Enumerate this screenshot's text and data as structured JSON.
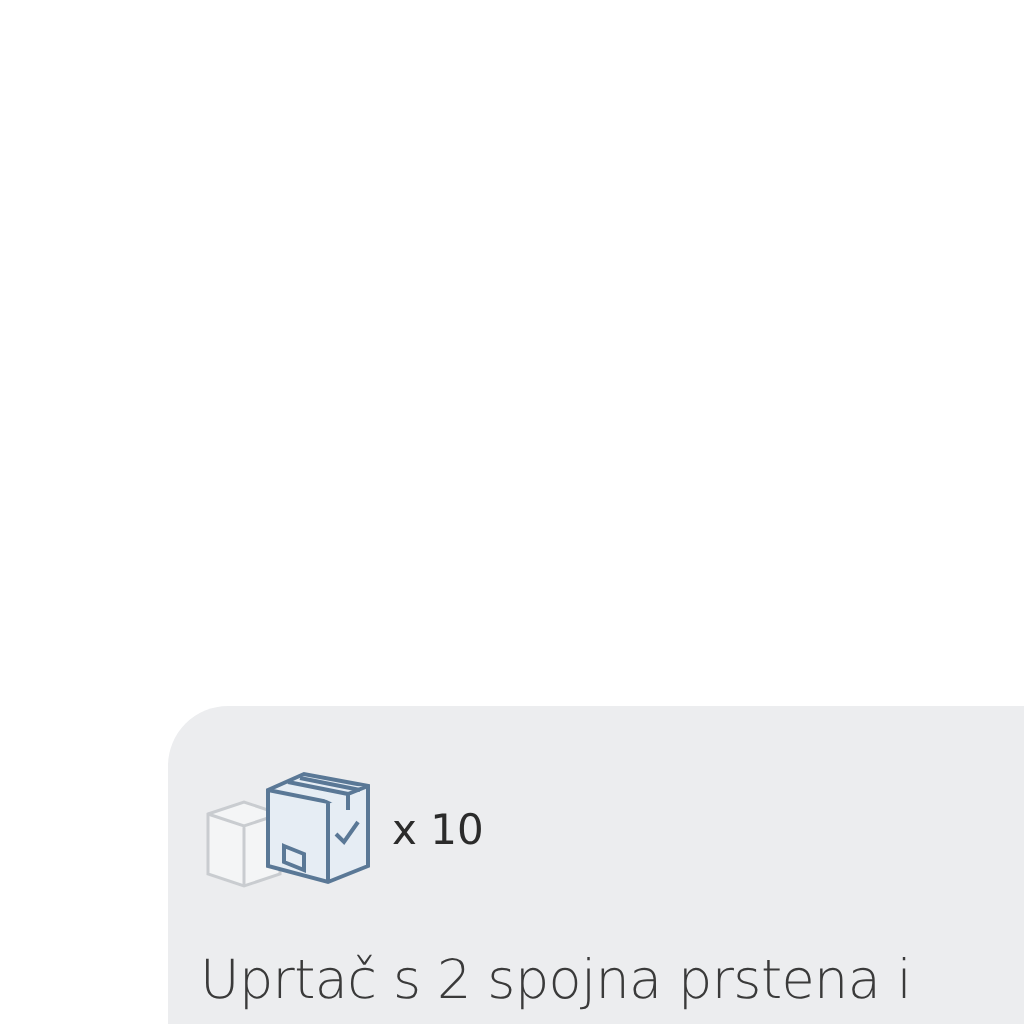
{
  "card": {
    "quantity": "x 10",
    "title": "Uprtač s 2 spojna prstena i"
  }
}
